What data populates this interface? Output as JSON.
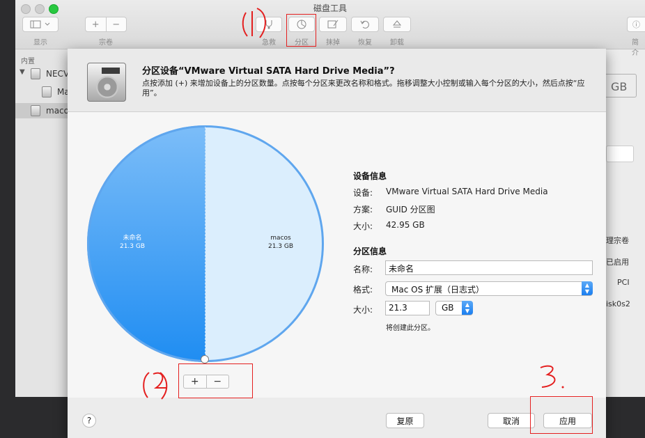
{
  "window": {
    "title": "磁盘工具"
  },
  "toolbar": {
    "view_label": "显示",
    "volume_label": "宗卷",
    "plus": "+",
    "minus": "−",
    "firstaid_label": "急救",
    "partition_label": "分区",
    "erase_label": "抹掉",
    "restore_label": "恢复",
    "unmount_label": "卸载",
    "info_label": "简介"
  },
  "sidebar": {
    "section": "内置",
    "items": [
      {
        "label": "NECV"
      },
      {
        "label": "Ma"
      },
      {
        "label": "macos"
      }
    ]
  },
  "background_fragments": [
    "GB",
    "理宗卷",
    "已启用",
    "PCI",
    "isk0s2"
  ],
  "sheet": {
    "title": "分区设备“VMware Virtual SATA Hard Drive Media”?",
    "description": "点按添加 (+) 来增加设备上的分区数量。点按每个分区来更改名称和格式。拖移调整大小控制或输入每个分区的大小，然后点按“应用”。"
  },
  "pie": {
    "partitions": [
      {
        "name": "未命名",
        "size": "21.3 GB",
        "value_gb": 21.3,
        "color": "#3a9bf5"
      },
      {
        "name": "macos",
        "size": "21.3 GB",
        "value_gb": 21.3,
        "color": "#dbeefd"
      }
    ],
    "add": "+",
    "remove": "−"
  },
  "device_info": {
    "heading": "设备信息",
    "device_label": "设备:",
    "device_value": "VMware Virtual SATA Hard Drive Media",
    "scheme_label": "方案:",
    "scheme_value": "GUID 分区图",
    "size_label": "大小:",
    "size_value": "42.95 GB"
  },
  "partition_info": {
    "heading": "分区信息",
    "name_label": "名称:",
    "name_value": "未命名",
    "format_label": "格式:",
    "format_value": "Mac OS 扩展（日志式）",
    "size_label": "大小:",
    "size_value": "21.3",
    "unit_value": "GB",
    "note": "将创建此分区。"
  },
  "buttons": {
    "help": "?",
    "revert": "复原",
    "cancel": "取消",
    "apply": "应用"
  },
  "annotations": {
    "color": "#e41f1f"
  }
}
